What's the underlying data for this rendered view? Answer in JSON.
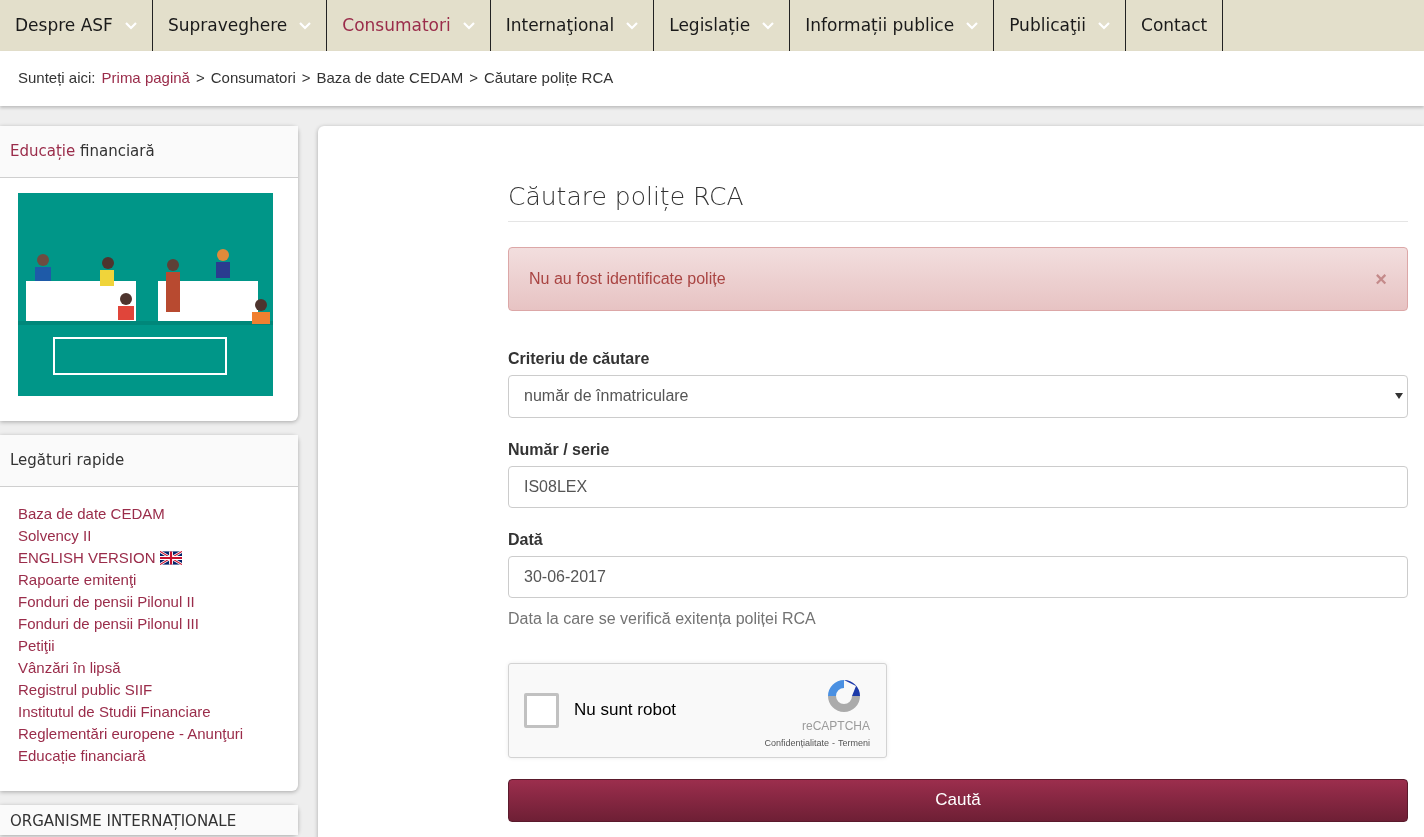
{
  "nav": [
    {
      "label": "Despre ASF",
      "dropdown": true,
      "selected": false
    },
    {
      "label": "Supraveghere",
      "dropdown": true,
      "selected": false
    },
    {
      "label": "Consumatori",
      "dropdown": true,
      "selected": true
    },
    {
      "label": "Internaţional",
      "dropdown": true,
      "selected": false
    },
    {
      "label": "Legislație",
      "dropdown": true,
      "selected": false
    },
    {
      "label": "Informații publice",
      "dropdown": true,
      "selected": false
    },
    {
      "label": "Publicaţii",
      "dropdown": true,
      "selected": false
    },
    {
      "label": "Contact",
      "dropdown": false,
      "selected": false
    }
  ],
  "breadcrumb": {
    "prefix": "Sunteți aici:",
    "items": [
      {
        "label": "Prima pagină",
        "link": true
      },
      {
        "label": "Consumatori",
        "link": false
      },
      {
        "label": "Baza de date CEDAM",
        "link": false
      },
      {
        "label": "Căutare polițe RCA",
        "link": false
      }
    ],
    "separator": ">"
  },
  "sidebar": [
    {
      "kind": "banner",
      "title_highlight": "Educație",
      "title_rest": "financiară"
    },
    {
      "kind": "links",
      "title_rest": "Legături rapide",
      "links": [
        {
          "label": "Baza de date CEDAM"
        },
        {
          "label": "Solvency II"
        },
        {
          "label": "ENGLISH VERSION",
          "flag": true
        },
        {
          "label": "Rapoarte emitenţi"
        },
        {
          "label": "Fonduri de pensii Pilonul II"
        },
        {
          "label": "Fonduri de pensii Pilonul III"
        },
        {
          "label": "Petiţii"
        },
        {
          "label": "Vânzări în lipsă"
        },
        {
          "label": "Registrul public SIIF"
        },
        {
          "label": "Institutul de Studii Financiare"
        },
        {
          "label": "Reglementări europene - Anunţuri"
        },
        {
          "label": "Educație financiară"
        }
      ]
    },
    {
      "kind": "heading",
      "title_rest": "ORGANISME INTERNAȚIONALE"
    }
  ],
  "form": {
    "title": "Căutare polițe RCA",
    "alert": {
      "message": "Nu au fost identificate polițe",
      "close": "×"
    },
    "fields": [
      {
        "kind": "select",
        "label": "Criteriu de căutare",
        "value": "număr de înmatriculare"
      },
      {
        "kind": "text",
        "label": "Număr / serie",
        "value": "IS08LEX"
      },
      {
        "kind": "text",
        "label": "Dată",
        "value": "30-06-2017",
        "help": "Data la care se verifică exitența poliței RCA"
      }
    ],
    "captcha": {
      "label": "Nu sunt robot",
      "checked": false,
      "brand": "reCAPTCHA",
      "privacy": "Confidențialitate",
      "separator": "-",
      "terms": "Termeni"
    },
    "submit": "Caută"
  }
}
